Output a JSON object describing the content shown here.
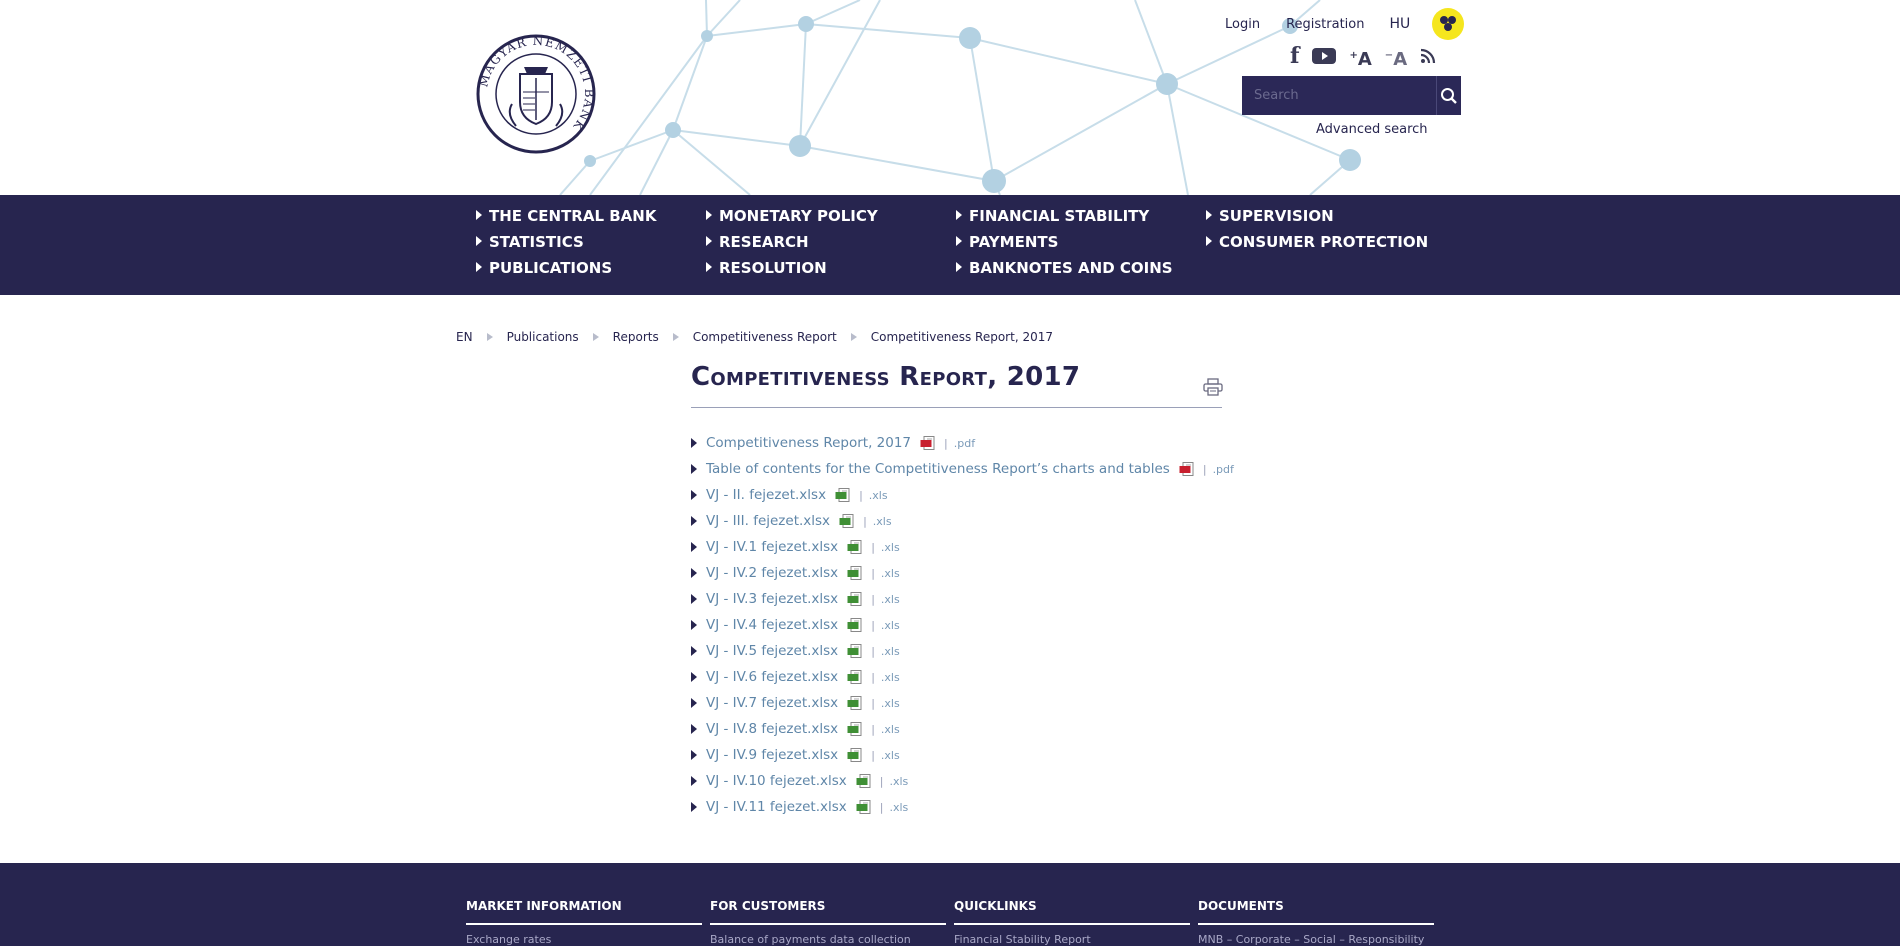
{
  "header": {
    "logo_text": "MAGYAR NEMZETI BANK",
    "login": "Login",
    "registration": "Registration",
    "language": "HU",
    "accessibility_icon": "low-vision-icon",
    "social_icons": [
      "facebook-icon",
      "youtube-icon",
      "font-increase-icon",
      "font-decrease-icon",
      "rss-icon"
    ],
    "search": {
      "placeholder": "Search",
      "value": ""
    },
    "advanced_search": "Advanced search"
  },
  "nav": {
    "items": [
      "THE CENTRAL BANK",
      "MONETARY POLICY",
      "FINANCIAL STABILITY",
      "SUPERVISION",
      "STATISTICS",
      "RESEARCH",
      "PAYMENTS",
      "CONSUMER PROTECTION",
      "PUBLICATIONS",
      "RESOLUTION",
      "BANKNOTES AND COINS"
    ]
  },
  "breadcrumb": [
    "EN",
    "Publications",
    "Reports",
    "Competitiveness Report",
    "Competitiveness Report, 2017"
  ],
  "page": {
    "title": "Competitiveness Report, 2017",
    "files": [
      {
        "name": "Competitiveness Report, 2017",
        "type": "pdf",
        "ext": ".pdf"
      },
      {
        "name": "Table of contents for the Competitiveness Report’s charts and tables",
        "type": "pdf",
        "ext": ".pdf"
      },
      {
        "name": "VJ - II. fejezet.xlsx",
        "type": "xls",
        "ext": ".xls"
      },
      {
        "name": "VJ - III. fejezet.xlsx",
        "type": "xls",
        "ext": ".xls"
      },
      {
        "name": "VJ - IV.1 fejezet.xlsx",
        "type": "xls",
        "ext": ".xls"
      },
      {
        "name": "VJ - IV.2 fejezet.xlsx",
        "type": "xls",
        "ext": ".xls"
      },
      {
        "name": "VJ - IV.3 fejezet.xlsx",
        "type": "xls",
        "ext": ".xls"
      },
      {
        "name": "VJ - IV.4 fejezet.xlsx",
        "type": "xls",
        "ext": ".xls"
      },
      {
        "name": "VJ - IV.5 fejezet.xlsx",
        "type": "xls",
        "ext": ".xls"
      },
      {
        "name": "VJ - IV.6 fejezet.xlsx",
        "type": "xls",
        "ext": ".xls"
      },
      {
        "name": "VJ - IV.7 fejezet.xlsx",
        "type": "xls",
        "ext": ".xls"
      },
      {
        "name": "VJ - IV.8 fejezet.xlsx",
        "type": "xls",
        "ext": ".xls"
      },
      {
        "name": "VJ - IV.9 fejezet.xlsx",
        "type": "xls",
        "ext": ".xls"
      },
      {
        "name": "VJ - IV.10 fejezet.xlsx",
        "type": "xls",
        "ext": ".xls"
      },
      {
        "name": "VJ - IV.11 fejezet.xlsx",
        "type": "xls",
        "ext": ".xls"
      }
    ]
  },
  "footer": {
    "columns": [
      {
        "heading": "MARKET INFORMATION",
        "item": "Exchange rates"
      },
      {
        "heading": "FOR CUSTOMERS",
        "item": "Balance of payments data collection"
      },
      {
        "heading": "QUICKLINKS",
        "item": "Financial Stability Report"
      },
      {
        "heading": "DOCUMENTS",
        "item": "MNB – Corporate – Social – Responsibility"
      }
    ]
  },
  "colors": {
    "navy": "#27254f",
    "link": "#5f86a8",
    "accessibility": "#f5e61e",
    "pdf": "#c8202f",
    "xls": "#3f8f35"
  }
}
